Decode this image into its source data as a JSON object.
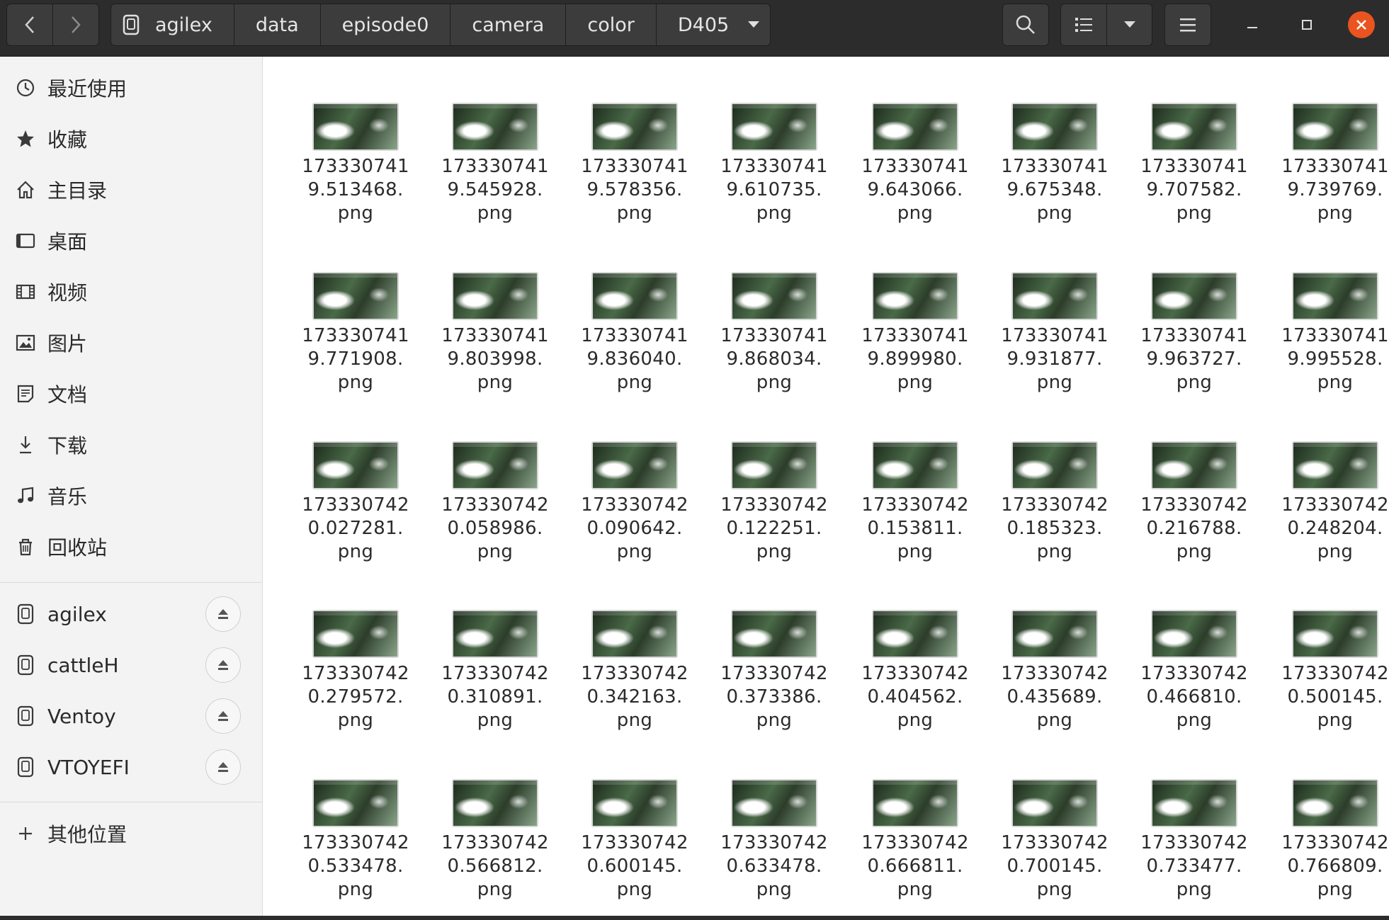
{
  "header": {
    "breadcrumbs": [
      {
        "label": "agilex"
      },
      {
        "label": "data"
      },
      {
        "label": "episode0"
      },
      {
        "label": "camera"
      },
      {
        "label": "color"
      },
      {
        "label": "D405"
      }
    ]
  },
  "sidebar": {
    "places": [
      {
        "label": "最近使用",
        "icon": "clock-icon"
      },
      {
        "label": "收藏",
        "icon": "star-icon"
      },
      {
        "label": "主目录",
        "icon": "home-icon"
      },
      {
        "label": "桌面",
        "icon": "desktop-icon"
      },
      {
        "label": "视频",
        "icon": "video-icon"
      },
      {
        "label": "图片",
        "icon": "image-icon"
      },
      {
        "label": "文档",
        "icon": "document-icon"
      },
      {
        "label": "下载",
        "icon": "download-icon"
      },
      {
        "label": "音乐",
        "icon": "music-icon"
      },
      {
        "label": "回收站",
        "icon": "trash-icon"
      }
    ],
    "devices": [
      {
        "label": "agilex"
      },
      {
        "label": "cattleH"
      },
      {
        "label": "Ventoy"
      },
      {
        "label": "VTOYEFI"
      }
    ],
    "other_locations": "其他位置"
  },
  "files": [
    {
      "l1": "173330741",
      "l2": "9.513468.",
      "l3": "png"
    },
    {
      "l1": "173330741",
      "l2": "9.545928.",
      "l3": "png"
    },
    {
      "l1": "173330741",
      "l2": "9.578356.",
      "l3": "png"
    },
    {
      "l1": "173330741",
      "l2": "9.610735.",
      "l3": "png"
    },
    {
      "l1": "173330741",
      "l2": "9.643066.",
      "l3": "png"
    },
    {
      "l1": "173330741",
      "l2": "9.675348.",
      "l3": "png"
    },
    {
      "l1": "173330741",
      "l2": "9.707582.",
      "l3": "png"
    },
    {
      "l1": "173330741",
      "l2": "9.739769.",
      "l3": "png"
    },
    {
      "l1": "173330741",
      "l2": "9.771908.",
      "l3": "png"
    },
    {
      "l1": "173330741",
      "l2": "9.803998.",
      "l3": "png"
    },
    {
      "l1": "173330741",
      "l2": "9.836040.",
      "l3": "png"
    },
    {
      "l1": "173330741",
      "l2": "9.868034.",
      "l3": "png"
    },
    {
      "l1": "173330741",
      "l2": "9.899980.",
      "l3": "png"
    },
    {
      "l1": "173330741",
      "l2": "9.931877.",
      "l3": "png"
    },
    {
      "l1": "173330741",
      "l2": "9.963727.",
      "l3": "png"
    },
    {
      "l1": "173330741",
      "l2": "9.995528.",
      "l3": "png"
    },
    {
      "l1": "173330742",
      "l2": "0.027281.",
      "l3": "png"
    },
    {
      "l1": "173330742",
      "l2": "0.058986.",
      "l3": "png"
    },
    {
      "l1": "173330742",
      "l2": "0.090642.",
      "l3": "png"
    },
    {
      "l1": "173330742",
      "l2": "0.122251.",
      "l3": "png"
    },
    {
      "l1": "173330742",
      "l2": "0.153811.",
      "l3": "png"
    },
    {
      "l1": "173330742",
      "l2": "0.185323.",
      "l3": "png"
    },
    {
      "l1": "173330742",
      "l2": "0.216788.",
      "l3": "png"
    },
    {
      "l1": "173330742",
      "l2": "0.248204.",
      "l3": "png"
    },
    {
      "l1": "173330742",
      "l2": "0.279572.",
      "l3": "png"
    },
    {
      "l1": "173330742",
      "l2": "0.310891.",
      "l3": "png"
    },
    {
      "l1": "173330742",
      "l2": "0.342163.",
      "l3": "png"
    },
    {
      "l1": "173330742",
      "l2": "0.373386.",
      "l3": "png"
    },
    {
      "l1": "173330742",
      "l2": "0.404562.",
      "l3": "png"
    },
    {
      "l1": "173330742",
      "l2": "0.435689.",
      "l3": "png"
    },
    {
      "l1": "173330742",
      "l2": "0.466810.",
      "l3": "png"
    },
    {
      "l1": "173330742",
      "l2": "0.500145.",
      "l3": "png"
    },
    {
      "l1": "173330742",
      "l2": "0.533478.",
      "l3": "png"
    },
    {
      "l1": "173330742",
      "l2": "0.566812.",
      "l3": "png"
    },
    {
      "l1": "173330742",
      "l2": "0.600145.",
      "l3": "png"
    },
    {
      "l1": "173330742",
      "l2": "0.633478.",
      "l3": "png"
    },
    {
      "l1": "173330742",
      "l2": "0.666811.",
      "l3": "png"
    },
    {
      "l1": "173330742",
      "l2": "0.700145.",
      "l3": "png"
    },
    {
      "l1": "173330742",
      "l2": "0.733477.",
      "l3": "png"
    },
    {
      "l1": "173330742",
      "l2": "0.766809.",
      "l3": "png"
    }
  ],
  "colors": {
    "headerbar": "#2c2c2c",
    "close_button": "#e95420",
    "sidebar": "#f3f3f3"
  }
}
